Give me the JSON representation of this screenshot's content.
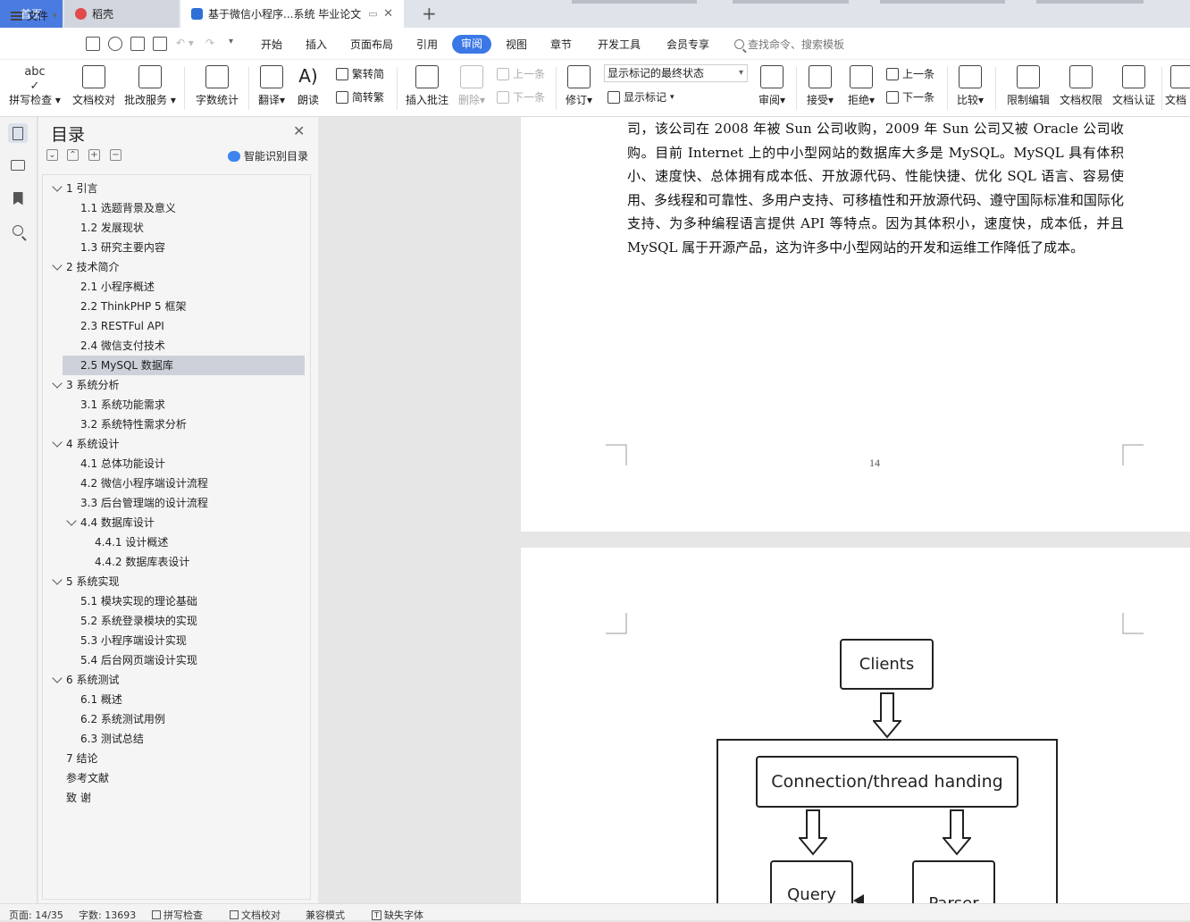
{
  "tabs": {
    "home": "首页",
    "docer": "稻壳",
    "doc": "基于微信小程序...系统 毕业论文",
    "add": "+",
    "close": "✕"
  },
  "menu": {
    "file": "文件",
    "items": [
      "开始",
      "插入",
      "页面布局",
      "引用",
      "审阅",
      "视图",
      "章节",
      "开发工具",
      "会员专享"
    ],
    "search_placeholder": "查找命令、搜索模板"
  },
  "ribbon": {
    "spell": "拼写检查",
    "proof": "文档校对",
    "correction": "批改服务",
    "wordcount": "字数统计",
    "translate": "翻译",
    "read": "朗读",
    "to_trad": "繁转简",
    "to_simp": "简转繁",
    "insert_comment": "插入批注",
    "delete": "删除",
    "prev_comment": "上一条",
    "next_comment": "下一条",
    "track": "修订",
    "markup_state": "显示标记的最终状态",
    "show_markup": "显示标记",
    "review": "审阅",
    "accept": "接受",
    "reject": "拒绝",
    "prev_change": "上一条",
    "next_change": "下一条",
    "compare": "比较",
    "restrict": "限制编辑",
    "permission": "文档权限",
    "certify": "文档认证",
    "truncated": "文档"
  },
  "toc": {
    "title": "目录",
    "ai_label": "智能识别目录",
    "items": [
      {
        "label": "1  引言",
        "level": 1,
        "expand": true
      },
      {
        "label": "1.1  选题背景及意义",
        "level": 2
      },
      {
        "label": "1.2  发展现状",
        "level": 2
      },
      {
        "label": "1.3  研究主要内容",
        "level": 2
      },
      {
        "label": "2  技术简介",
        "level": 1,
        "expand": true
      },
      {
        "label": "2.1  小程序概述",
        "level": 2
      },
      {
        "label": "2.2 ThinkPHP 5  框架",
        "level": 2
      },
      {
        "label": "2.3 RESTFul API",
        "level": 2
      },
      {
        "label": "2.4  微信支付技术",
        "level": 2
      },
      {
        "label": "2.5 MySQL 数据库",
        "level": 2,
        "selected": true
      },
      {
        "label": "3  系统分析",
        "level": 1,
        "expand": true
      },
      {
        "label": "3.1  系统功能需求",
        "level": 2
      },
      {
        "label": "3.2  系统特性需求分析",
        "level": 2
      },
      {
        "label": "4  系统设计",
        "level": 1,
        "expand": true
      },
      {
        "label": "4.1  总体功能设计",
        "level": 2
      },
      {
        "label": "4.2  微信小程序端设计流程",
        "level": 2
      },
      {
        "label": "3.3  后台管理端的设计流程",
        "level": 2
      },
      {
        "label": "4.4  数据库设计",
        "level": 2,
        "expand": true
      },
      {
        "label": "4.4.1  设计概述",
        "level": 3
      },
      {
        "label": "4.4.2  数据库表设计",
        "level": 3
      },
      {
        "label": "5  系统实现",
        "level": 1,
        "expand": true
      },
      {
        "label": "5.1  模块实现的理论基础",
        "level": 2
      },
      {
        "label": "5.2  系统登录模块的实现",
        "level": 2
      },
      {
        "label": "5.3  小程序端设计实现",
        "level": 2
      },
      {
        "label": "5.4  后台网页端设计实现",
        "level": 2
      },
      {
        "label": "6  系统测试",
        "level": 1,
        "expand": true
      },
      {
        "label": "6.1  概述",
        "level": 2
      },
      {
        "label": "6.2  系统测试用例",
        "level": 2
      },
      {
        "label": "6.3  测试总结",
        "level": 2
      },
      {
        "label": "7  结论",
        "level": 1
      },
      {
        "label": "参考文献",
        "level": 1
      },
      {
        "label": "致    谢",
        "level": 1
      }
    ]
  },
  "document": {
    "paragraph": "司，该公司在 2008 年被 Sun 公司收购，2009 年 Sun 公司又被 Oracle 公司收购。目前 Internet 上的中小型网站的数据库大多是 MySQL。MySQL 具有体积小、速度快、总体拥有成本低、开放源代码、性能快捷、优化 SQL 语言、容易使用、多线程和可靠性、多用户支持、可移植性和开放源代码、遵守国际标准和国际化支持、为多种编程语言提供 API 等特点。因为其体积小，速度快，成本低，并且 MySQL 属于开源产品，这为许多中小型网站的开发和运维工作降低了成本。",
    "page_number": "14",
    "diagram": {
      "clients": "Clients",
      "connection": "Connection/thread handing",
      "query": "Query",
      "parser": "Parser"
    }
  },
  "status": {
    "page": "页面: 14/35",
    "words": "字数: 13693",
    "spell": "拼写检查",
    "proof": "文档校对",
    "compat": "兼容模式",
    "missing_font": "缺失字体"
  }
}
